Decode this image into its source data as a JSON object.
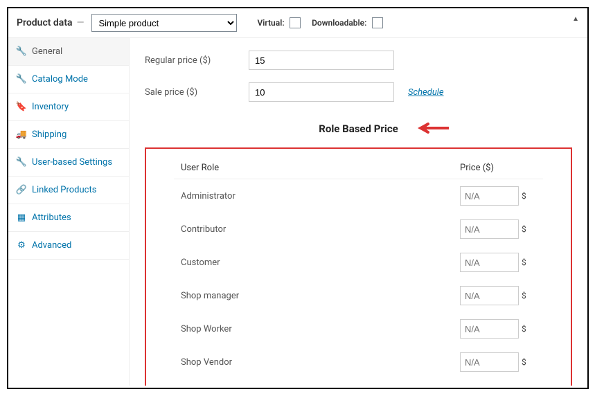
{
  "panel": {
    "title": "Product data",
    "product_type": "Simple product",
    "virtual_label": "Virtual:",
    "downloadable_label": "Downloadable:"
  },
  "sidebar": {
    "items": [
      {
        "label": "General",
        "icon": "wrench"
      },
      {
        "label": "Catalog Mode",
        "icon": "wrench"
      },
      {
        "label": "Inventory",
        "icon": "tag"
      },
      {
        "label": "Shipping",
        "icon": "truck"
      },
      {
        "label": "User-based Settings",
        "icon": "wrench"
      },
      {
        "label": "Linked Products",
        "icon": "link"
      },
      {
        "label": "Attributes",
        "icon": "list"
      },
      {
        "label": "Advanced",
        "icon": "gear"
      }
    ]
  },
  "main": {
    "regular_price_label": "Regular price ($)",
    "regular_price_value": "15",
    "sale_price_label": "Sale price ($)",
    "sale_price_value": "10",
    "schedule_label": "Schedule",
    "section_title": "Role Based Price",
    "role_table": {
      "col1": "User Role",
      "col2": "Price ($)",
      "rows": [
        {
          "role": "Administrator",
          "placeholder": "N/A"
        },
        {
          "role": "Contributor",
          "placeholder": "N/A"
        },
        {
          "role": "Customer",
          "placeholder": "N/A"
        },
        {
          "role": "Shop manager",
          "placeholder": "N/A"
        },
        {
          "role": "Shop Worker",
          "placeholder": "N/A"
        },
        {
          "role": "Shop Vendor",
          "placeholder": "N/A"
        }
      ],
      "currency": "$"
    }
  }
}
